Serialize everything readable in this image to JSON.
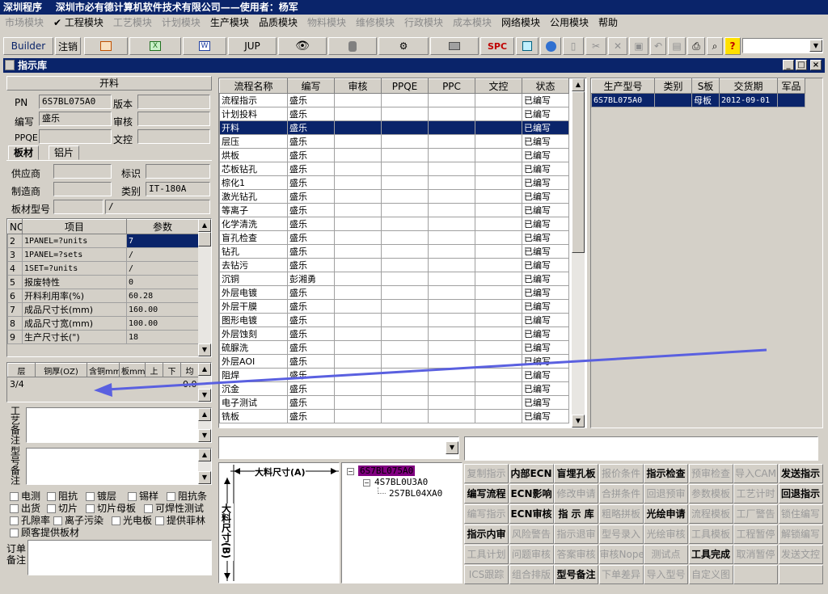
{
  "app": {
    "title": "深圳程序    深圳市必有德计算机软件技术有限公司——使用者：杨军"
  },
  "menu": [
    {
      "label": "市场模块",
      "enabled": false
    },
    {
      "label": "✔ 工程模块",
      "enabled": true
    },
    {
      "label": "工艺模块",
      "enabled": false
    },
    {
      "label": "计划模块",
      "enabled": false
    },
    {
      "label": "生产模块",
      "enabled": true
    },
    {
      "label": "品质模块",
      "enabled": true
    },
    {
      "label": "物料模块",
      "enabled": false
    },
    {
      "label": "维修模块",
      "enabled": false
    },
    {
      "label": "行政模块",
      "enabled": false
    },
    {
      "label": "成本模块",
      "enabled": false
    },
    {
      "label": "网络模块",
      "enabled": true
    },
    {
      "label": "公用模块",
      "enabled": true
    },
    {
      "label": "帮助",
      "enabled": true
    }
  ],
  "toolbar": {
    "builder": "Builder",
    "logout": "注销",
    "jup": "JUP",
    "spc": "SPC"
  },
  "window": {
    "title": "指示库"
  },
  "left": {
    "section_title": "开料",
    "pn_label": "PN",
    "pn_value": "6S7BL075A0",
    "version_label": "版本",
    "version_value": "",
    "writer_label": "编写",
    "writer_value": "盛乐",
    "audit_label": "审核",
    "audit_value": "",
    "ppqe_label": "PPQE",
    "ppqe_value": "",
    "doc_label": "文控",
    "doc_value": "",
    "tabs": [
      "板材",
      "铝片"
    ],
    "supplier_label": "供应商",
    "supplier_value": "",
    "mark_label": "标识",
    "mark_value": "",
    "maker_label": "制造商",
    "maker_value": "",
    "category_label": "类别",
    "category_value": "IT-180A",
    "model_label": "板材型号",
    "model_value": "",
    "model_value2": "/",
    "param_headers": [
      "NO",
      "项目",
      "参数"
    ],
    "params": [
      {
        "no": "2",
        "item": "1PANEL=?units",
        "val": "7"
      },
      {
        "no": "3",
        "item": "1PANEL=?sets",
        "val": "/"
      },
      {
        "no": "4",
        "item": "1SET=?units",
        "val": "/"
      },
      {
        "no": "5",
        "item": "报废特性",
        "val": "0"
      },
      {
        "no": "6",
        "item": "开料利用率(%)",
        "val": "60.28"
      },
      {
        "no": "7",
        "item": "成品尺寸长(mm)",
        "val": "160.00"
      },
      {
        "no": "8",
        "item": "成品尺寸宽(mm)",
        "val": "100.00"
      },
      {
        "no": "9",
        "item": "生产尺寸长(\")",
        "val": "18"
      }
    ],
    "layer_headers": [
      "层",
      "铜厚(OZ)",
      "含铜mm",
      "板mm",
      "上",
      "下",
      "均"
    ],
    "layer_row": {
      "layer": "3/4",
      "avg": "0.0"
    },
    "process_note_label": "工艺备注",
    "type_note_label": "型号备注",
    "checkboxes": [
      "电测",
      "阻抗",
      "镀层",
      "锡样",
      "阻抗条",
      "出货",
      "切片",
      "切片母板",
      "可焊性测试",
      "孔隙率",
      "离子污染",
      "光电板",
      "提供菲林",
      "顾客提供板材"
    ],
    "order_note_label": "订单备注"
  },
  "flow": {
    "headers": [
      "流程名称",
      "编写",
      "审核",
      "PPQE",
      "PPC",
      "文控",
      "状态"
    ],
    "rows": [
      {
        "name": "流程指示",
        "writer": "盛乐",
        "status": "已编写"
      },
      {
        "name": "计划投料",
        "writer": "盛乐",
        "status": "已编写"
      },
      {
        "name": "开料",
        "writer": "盛乐",
        "status": "已编写"
      },
      {
        "name": "层压",
        "writer": "盛乐",
        "status": "已编写"
      },
      {
        "name": "烘板",
        "writer": "盛乐",
        "status": "已编写"
      },
      {
        "name": "芯板钻孔",
        "writer": "盛乐",
        "status": "已编写"
      },
      {
        "name": "棕化1",
        "writer": "盛乐",
        "status": "已编写"
      },
      {
        "name": "激光钻孔",
        "writer": "盛乐",
        "status": "已编写"
      },
      {
        "name": "等离子",
        "writer": "盛乐",
        "status": "已编写"
      },
      {
        "name": "化学清洗",
        "writer": "盛乐",
        "status": "已编写"
      },
      {
        "name": "盲孔检查",
        "writer": "盛乐",
        "status": "已编写"
      },
      {
        "name": "钻孔",
        "writer": "盛乐",
        "status": "已编写"
      },
      {
        "name": "去钻污",
        "writer": "盛乐",
        "status": "已编写"
      },
      {
        "name": "沉铜",
        "writer": "彭湘勇",
        "status": "已编写"
      },
      {
        "name": "外层电镀",
        "writer": "盛乐",
        "status": "已编写"
      },
      {
        "name": "外层干膜",
        "writer": "盛乐",
        "status": "已编写"
      },
      {
        "name": "图形电镀",
        "writer": "盛乐",
        "status": "已编写"
      },
      {
        "name": "外层蚀刻",
        "writer": "盛乐",
        "status": "已编写"
      },
      {
        "name": "硫脲洗",
        "writer": "盛乐",
        "status": "已编写"
      },
      {
        "name": "外层AOI",
        "writer": "盛乐",
        "status": "已编写"
      },
      {
        "name": "阻焊",
        "writer": "盛乐",
        "status": "已编写"
      },
      {
        "name": "沉金",
        "writer": "盛乐",
        "status": "已编写"
      },
      {
        "name": "电子测试",
        "writer": "盛乐",
        "status": "已编写"
      },
      {
        "name": "铣板",
        "writer": "盛乐",
        "status": "已编写"
      }
    ]
  },
  "product": {
    "headers": [
      "生产型号",
      "类别",
      "S板",
      "交货期",
      "军品"
    ],
    "rows": [
      {
        "model": "6S7BL075A0",
        "type": "",
        "sboard": "母板",
        "date": "2012-09-01",
        "mil": ""
      }
    ]
  },
  "diagram": {
    "a_label": "大料尺寸(A)",
    "b_label": "大料尺寸(B)"
  },
  "tree": [
    "6S7BL075A0",
    "4S7BL0U3A0",
    "2S7BL04XA0"
  ],
  "actions": [
    [
      "复制指示",
      "内部ECN",
      "盲埋孔板",
      "报价条件",
      "指示检查",
      "预审检查",
      "导入CAM",
      "发送指示"
    ],
    [
      "编写流程",
      "ECN影响",
      "修改申请",
      "合拼条件",
      "回退预审",
      "参数模板",
      "工艺计时",
      "回退指示"
    ],
    [
      "编写指示",
      "ECN审核",
      "指 示 库",
      "粗略拼板",
      "光绘申请",
      "流程模板",
      "工厂警告",
      "锁住编写"
    ],
    [
      "指示内审",
      "风险警告",
      "指示退审",
      "型号录入",
      "光绘审核",
      "工具模板",
      "工程暂停",
      "解锁编写"
    ],
    [
      "工具计划",
      "问题审核",
      "答案审核",
      "审核Nope",
      "测试点",
      "工具完成",
      "取消暂停",
      "发送文控"
    ],
    [
      "ICS跟踪",
      "组合排版",
      "型号备注",
      "下单差异",
      "导入型号",
      "自定义图",
      "",
      ""
    ]
  ],
  "actions_enabled": [
    [
      false,
      true,
      true,
      false,
      true,
      false,
      false,
      true
    ],
    [
      true,
      true,
      false,
      false,
      false,
      false,
      false,
      true
    ],
    [
      false,
      true,
      true,
      false,
      true,
      false,
      false,
      false
    ],
    [
      true,
      false,
      false,
      false,
      false,
      false,
      false,
      false
    ],
    [
      false,
      false,
      false,
      false,
      false,
      true,
      false,
      false
    ],
    [
      false,
      false,
      true,
      false,
      false,
      false,
      false,
      false
    ]
  ]
}
